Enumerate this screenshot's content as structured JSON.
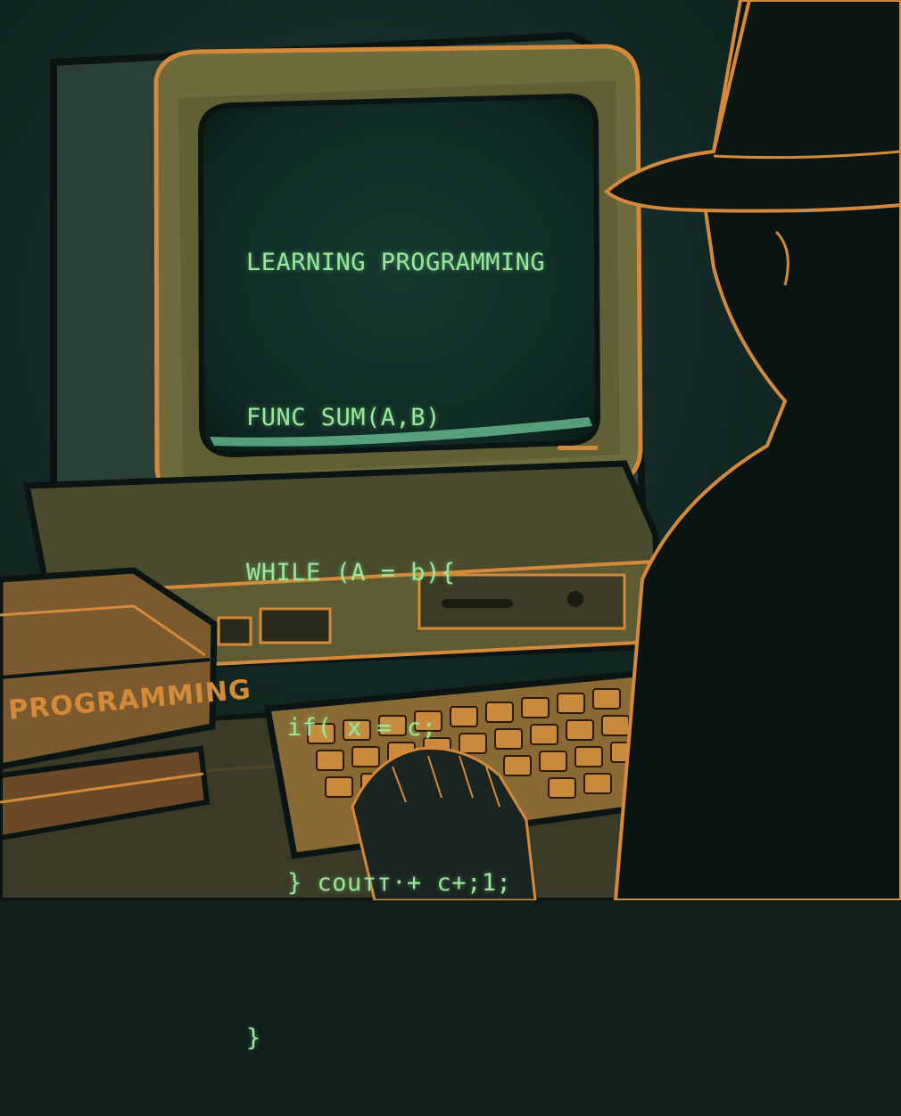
{
  "scene": {
    "colors": {
      "background": "#0e1f1c",
      "wall": "#16302b",
      "outline": "#d48a3a",
      "crt_text": "#9be89a",
      "crt_glass": "#0f2a24",
      "shadow_figure": "#0a1412"
    }
  },
  "monitor": {
    "screen_lines": [
      "LEARNING PROGRAMMING",
      "FUNC SUM(A,B)",
      "WHILE (A = b){",
      "if( x = c;",
      "} couтт·+ c+;1;",
      "}"
    ]
  },
  "book": {
    "spine_title": "PROGRAMMING"
  }
}
